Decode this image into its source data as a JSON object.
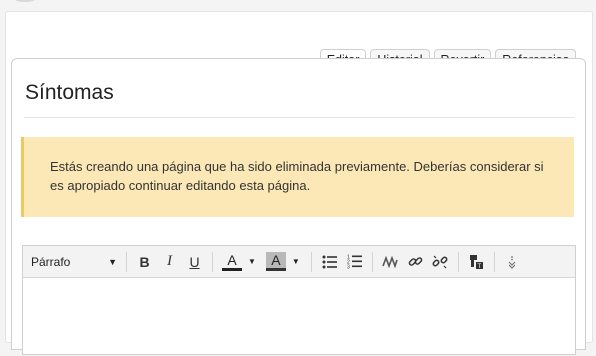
{
  "tabs": [
    {
      "label": "Editar"
    },
    {
      "label": "Historial"
    },
    {
      "label": "Revertir"
    },
    {
      "label": "Referencias"
    }
  ],
  "page": {
    "title": "Síntomas"
  },
  "notice": {
    "text": "Estás creando una página que ha sido eliminada previamente. Deberías considerar si es apropiado continuar editando esta página."
  },
  "editor": {
    "format_select": "Párrafo",
    "toolbar_icons": [
      "bold-icon",
      "italic-icon",
      "underline-icon",
      "text-color-icon",
      "background-color-icon",
      "bullet-list-icon",
      "numbered-list-icon",
      "clear-format-icon",
      "link-icon",
      "unlink-icon",
      "source-icon",
      "more-icon"
    ],
    "bold_glyph": "B",
    "italic_glyph": "I",
    "underline_glyph": "U",
    "text_color_glyph": "A",
    "bg_color_glyph": "A"
  }
}
